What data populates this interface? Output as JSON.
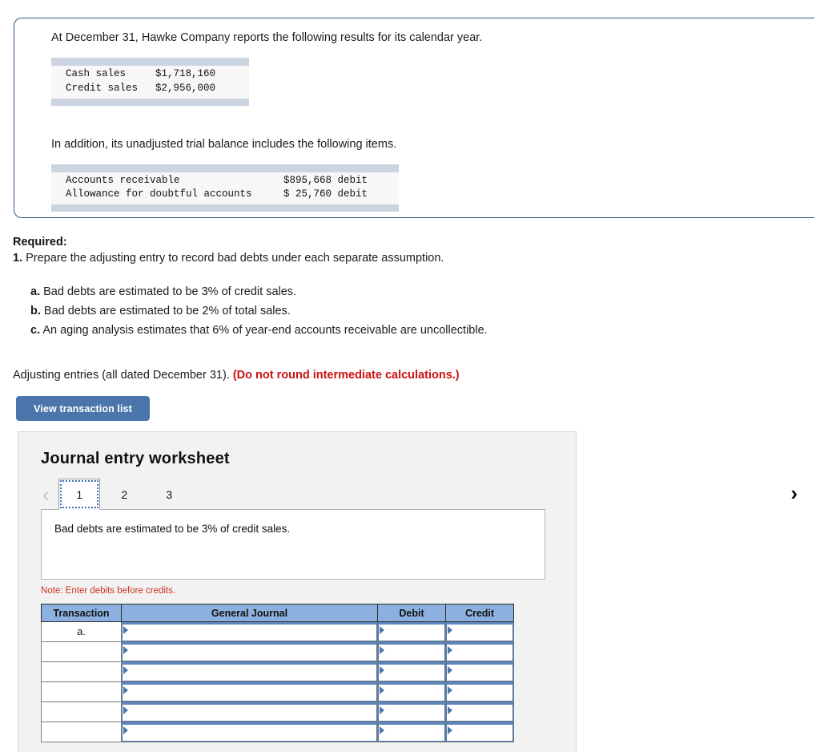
{
  "problem": {
    "intro_1": "At December 31, Hawke Company reports the following results for its calendar year.",
    "intro_2": "In addition, its unadjusted trial balance includes the following items.",
    "sales_table": [
      {
        "label": "Cash sales",
        "value": "$1,718,160"
      },
      {
        "label": "Credit sales",
        "value": "$2,956,000"
      }
    ],
    "trial_balance_table": [
      {
        "label": "Accounts receivable",
        "value": "$895,668 debit"
      },
      {
        "label": "Allowance for doubtful accounts",
        "value": "$ 25,760 debit"
      }
    ]
  },
  "required": {
    "heading": "Required:",
    "item_number": "1.",
    "item_text": " Prepare the adjusting entry to record bad debts under each separate assumption.",
    "assumptions": [
      {
        "letter": "a.",
        "text": " Bad debts are estimated to be 3% of credit sales."
      },
      {
        "letter": "b.",
        "text": " Bad debts are estimated to be 2% of total sales."
      },
      {
        "letter": "c.",
        "text": " An aging analysis estimates that 6% of year-end accounts receivable are uncollectible."
      }
    ],
    "adjusting_prefix": "Adjusting entries (all dated December 31). ",
    "adjusting_warning": "(Do not round intermediate calculations.)"
  },
  "toolbar": {
    "view_transaction_list_label": "View transaction list"
  },
  "worksheet": {
    "title": "Journal entry worksheet",
    "prev_chevron": "‹",
    "next_chevron": "›",
    "tabs": [
      {
        "label": "1",
        "active": true
      },
      {
        "label": "2",
        "active": false
      },
      {
        "label": "3",
        "active": false
      }
    ],
    "prompt": "Bad debts are estimated to be 3% of credit sales.",
    "note": "Note: Enter debits before credits.",
    "table": {
      "headers": [
        "Transaction",
        "General Journal",
        "Debit",
        "Credit"
      ],
      "rows": [
        {
          "transaction": "a.",
          "general_journal": "",
          "debit": "",
          "credit": ""
        },
        {
          "transaction": "",
          "general_journal": "",
          "debit": "",
          "credit": ""
        },
        {
          "transaction": "",
          "general_journal": "",
          "debit": "",
          "credit": ""
        },
        {
          "transaction": "",
          "general_journal": "",
          "debit": "",
          "credit": ""
        },
        {
          "transaction": "",
          "general_journal": "",
          "debit": "",
          "credit": ""
        },
        {
          "transaction": "",
          "general_journal": "",
          "debit": "",
          "credit": ""
        }
      ]
    }
  },
  "colors": {
    "card_border": "#31557f",
    "button_blue": "#4a76ac",
    "table_header_blue": "#8cb0df",
    "warning_red": "#cc1111",
    "note_red": "#cc3322",
    "panel_gray": "#f2f2f2",
    "data_bar": "#ccd4e2"
  }
}
